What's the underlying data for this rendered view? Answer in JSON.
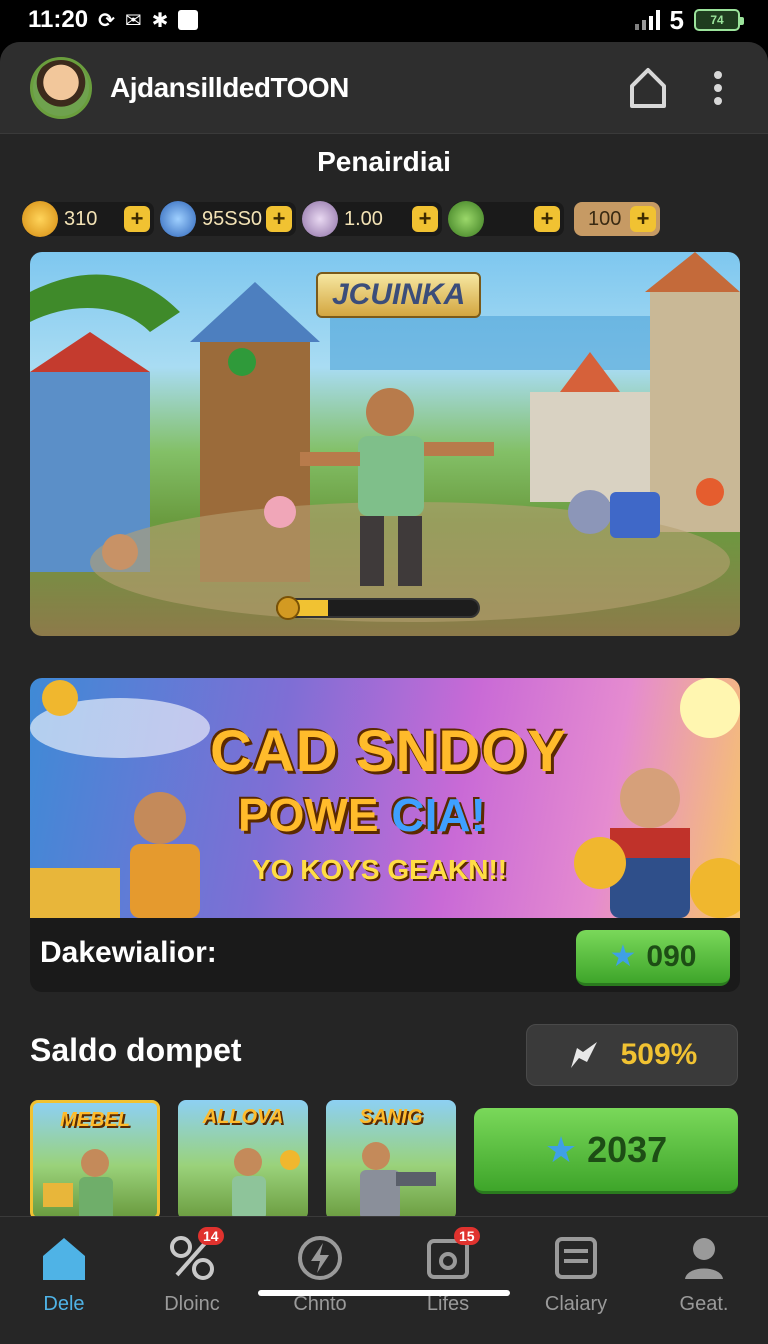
{
  "status_bar": {
    "time": "11:20",
    "signal_number": "5",
    "battery": "74"
  },
  "header": {
    "username": "AjdansilldedTOON",
    "home_icon": "home-icon",
    "menu_icon": "more-vertical-icon"
  },
  "section_title": "Penairdiai",
  "currencies": [
    {
      "icon": "gold-coin-icon",
      "value": "310",
      "color": "#f1a81f"
    },
    {
      "icon": "blue-gem-icon",
      "value": "95SS0",
      "color": "#3f7fd6"
    },
    {
      "icon": "silver-ore-icon",
      "value": "1.00",
      "color": "#b9a5c8"
    },
    {
      "icon": "green-gem-icon",
      "value": "",
      "color": "#5aa03a"
    }
  ],
  "currency_extra": "100",
  "hero": {
    "title": "JCUINKA",
    "progress": 0.25
  },
  "promo": {
    "line1": "CAD SNDOY",
    "line2_a": "POWE",
    "line2_b": "CIA!",
    "line3": "YO KOYS GEAKN!!",
    "label": "Dakewialior:",
    "button_value": "090"
  },
  "wallet": {
    "title": "Saldo dompet",
    "percent": "509%",
    "cards": [
      "MEBEL",
      "ALLOVA",
      "SANIG"
    ],
    "button_value": "2037"
  },
  "nav": [
    {
      "label": "Dele",
      "icon": "home-icon",
      "active": true,
      "badge": ""
    },
    {
      "label": "Dloinc",
      "icon": "link-icon",
      "active": false,
      "badge": "14"
    },
    {
      "label": "Chnto",
      "icon": "lightning-icon",
      "active": false,
      "badge": ""
    },
    {
      "label": "Lifes",
      "icon": "camera-icon",
      "active": false,
      "badge": "15"
    },
    {
      "label": "Claiary",
      "icon": "list-icon",
      "active": false,
      "badge": ""
    },
    {
      "label": "Geat.",
      "icon": "user-icon",
      "active": false,
      "badge": ""
    }
  ]
}
